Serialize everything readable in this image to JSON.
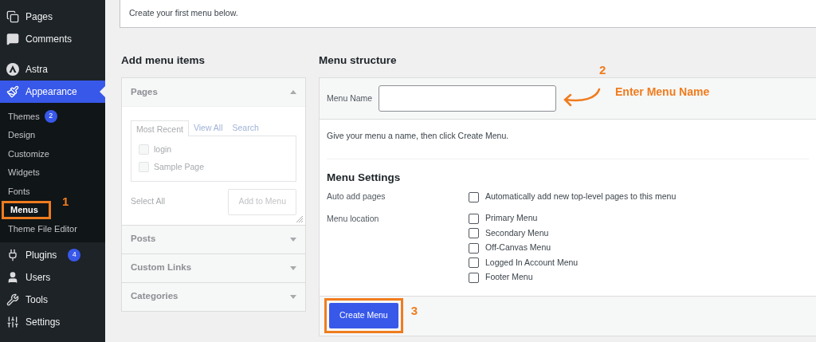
{
  "sidebar": {
    "items": [
      {
        "label": "Pages",
        "selected": false
      },
      {
        "label": "Comments",
        "selected": false
      },
      {
        "label": "Astra",
        "selected": false
      },
      {
        "label": "Appearance",
        "selected": true,
        "children": [
          {
            "label": "Themes",
            "badge": "2",
            "selected": false,
            "highlighted": false
          },
          {
            "label": "Design",
            "selected": false,
            "highlighted": false
          },
          {
            "label": "Customize",
            "selected": false,
            "highlighted": false
          },
          {
            "label": "Widgets",
            "selected": false,
            "highlighted": false
          },
          {
            "label": "Fonts",
            "selected": false,
            "highlighted": false
          },
          {
            "label": "Menus",
            "selected": true,
            "highlighted": true,
            "step": "1"
          },
          {
            "label": "Theme File Editor",
            "selected": false,
            "highlighted": false
          }
        ]
      },
      {
        "label": "Plugins",
        "badge": "4",
        "selected": false
      },
      {
        "label": "Users",
        "selected": false
      },
      {
        "label": "Tools",
        "selected": false
      },
      {
        "label": "Settings",
        "selected": false
      }
    ]
  },
  "notice": "Create your first menu below.",
  "add_menu_items": {
    "title": "Add menu items",
    "sections": [
      {
        "title": "Pages",
        "expanded": true,
        "tabs": [
          {
            "label": "Most Recent",
            "selected": true
          },
          {
            "label": "View All",
            "selected": false
          },
          {
            "label": "Search",
            "selected": false
          }
        ],
        "items": [
          {
            "label": "login",
            "checked": false
          },
          {
            "label": "Sample Page",
            "checked": false
          }
        ],
        "select_all": "Select All",
        "button": "Add to Menu"
      },
      {
        "title": "Posts",
        "expanded": false
      },
      {
        "title": "Custom Links",
        "expanded": false
      },
      {
        "title": "Categories",
        "expanded": false
      }
    ]
  },
  "menu_structure": {
    "title": "Menu structure",
    "name_label": "Menu Name",
    "hint": "Give your menu a name, then click Create Menu.",
    "step": "2",
    "step_text": "Enter Menu Name",
    "settings_title": "Menu Settings",
    "auto_add": {
      "label": "Auto add pages",
      "option": {
        "label": "Automatically add new top-level pages to this menu",
        "checked": false
      }
    },
    "location": {
      "label": "Menu location",
      "options": [
        {
          "label": "Primary Menu",
          "checked": false
        },
        {
          "label": "Secondary Menu",
          "checked": false
        },
        {
          "label": "Off-Canvas Menu",
          "checked": false
        },
        {
          "label": "Logged In Account Menu",
          "checked": false
        },
        {
          "label": "Footer Menu",
          "checked": false
        }
      ]
    },
    "create_button": {
      "label": "Create Menu",
      "highlighted": true,
      "step": "3"
    }
  }
}
